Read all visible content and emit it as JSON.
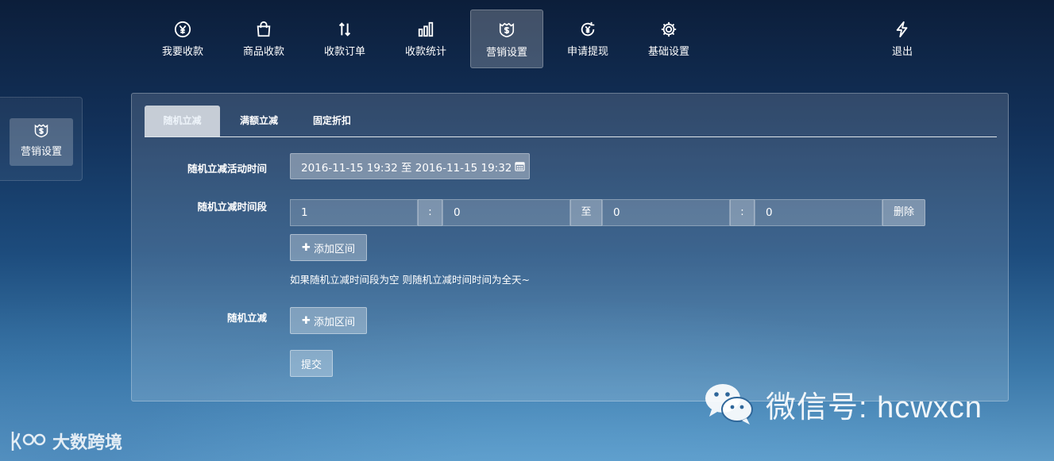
{
  "nav": {
    "items": [
      {
        "label": "我要收款",
        "icon": "yen-circle-icon"
      },
      {
        "label": "商品收款",
        "icon": "shopping-bag-icon"
      },
      {
        "label": "收款订单",
        "icon": "sort-arrows-icon"
      },
      {
        "label": "收款统计",
        "icon": "bar-chart-icon"
      },
      {
        "label": "营销设置",
        "icon": "marketing-shield-icon",
        "active": true
      },
      {
        "label": "申请提现",
        "icon": "withdraw-yen-icon"
      },
      {
        "label": "基础设置",
        "icon": "gear-icon"
      },
      {
        "label": "退出",
        "icon": "lightning-icon"
      }
    ]
  },
  "sidebar": {
    "items": [
      {
        "label": "营销设置",
        "icon": "marketing-shield-icon"
      }
    ]
  },
  "tabs": [
    {
      "label": "随机立减",
      "active": true
    },
    {
      "label": "满额立减"
    },
    {
      "label": "固定折扣"
    }
  ],
  "form": {
    "activity_time_label": "随机立减活动时间",
    "activity_time_value": "2016-11-15 19:32 至 2016-11-15 19:32",
    "period_label": "随机立减时间段",
    "period": {
      "start_hour": "1",
      "start_minute": "0",
      "end_hour": "0",
      "end_minute": "0",
      "colon": ":",
      "to": "至",
      "delete": "删除"
    },
    "add_interval_label": "添加区间",
    "add_interval_plus": "✚",
    "hint": "如果随机立减时间段为空 则随机立减时间时间为全天~",
    "random_label": "随机立减",
    "add_interval2_label": "添加区间",
    "submit": "提交"
  },
  "watermark": {
    "wechat_text": "微信号: hcwxcn",
    "brand_text": "大数跨境"
  },
  "colors": {
    "background_top": "#0c1e3a",
    "background_bottom": "#5f9cc8"
  }
}
